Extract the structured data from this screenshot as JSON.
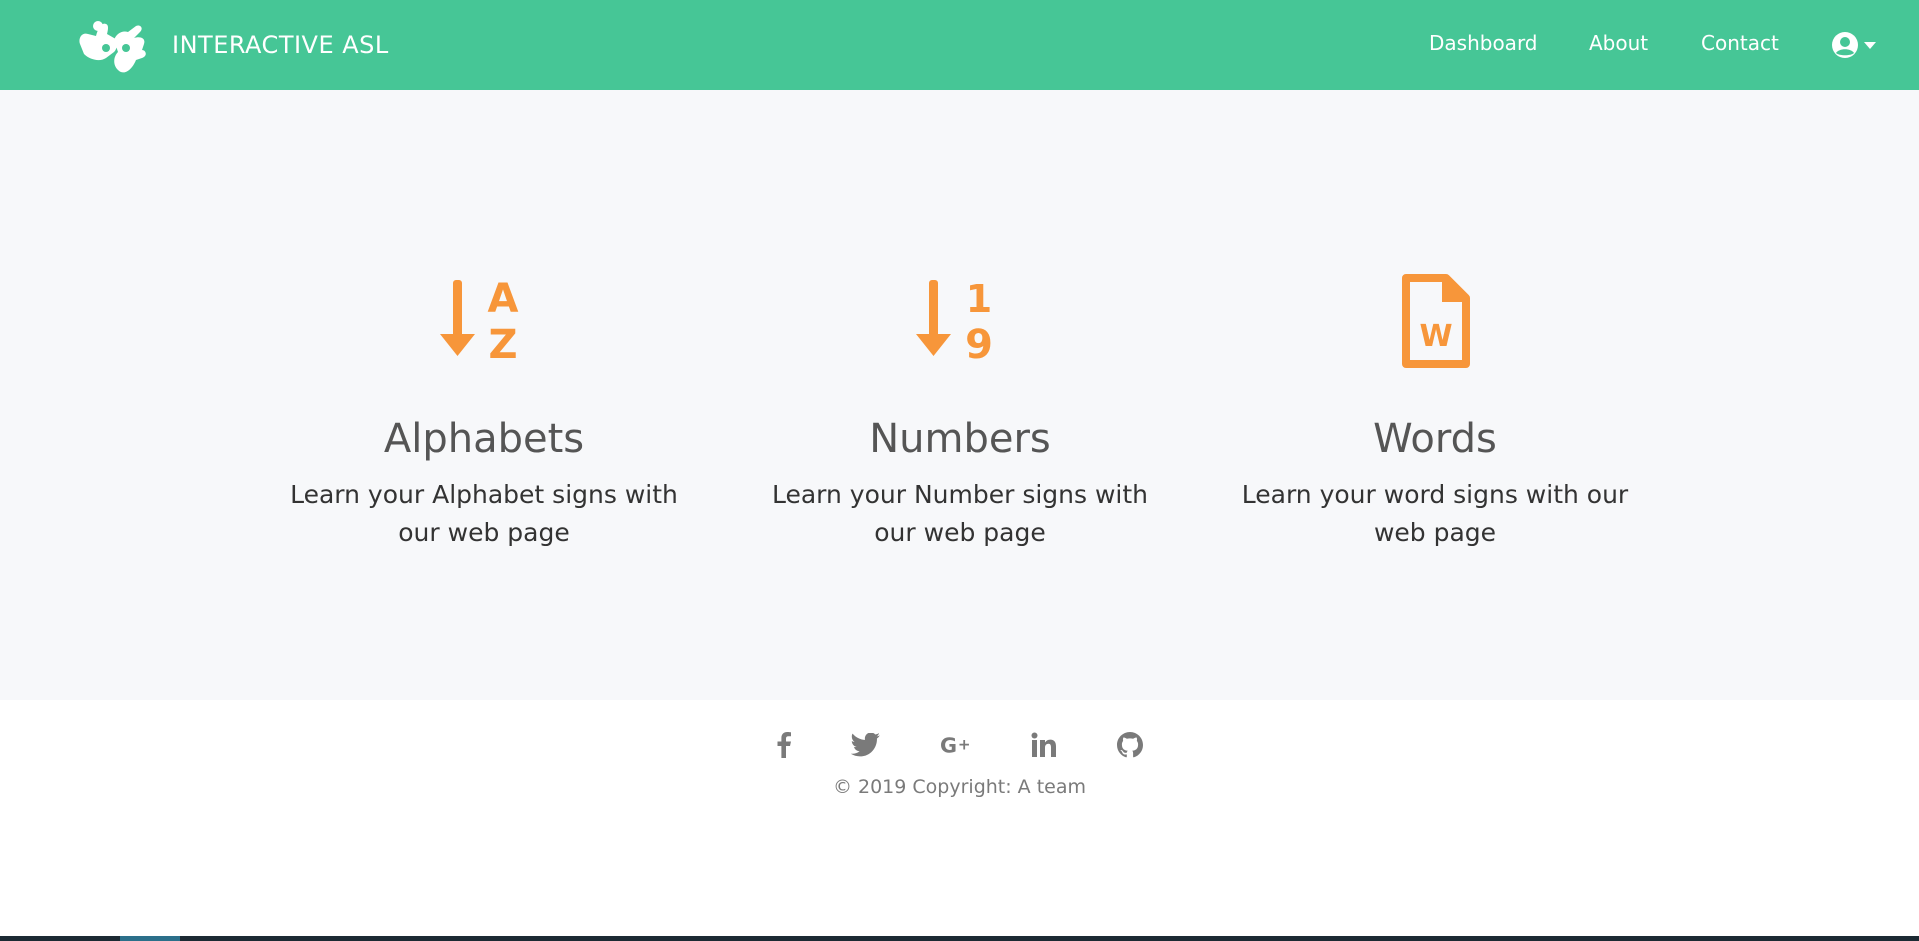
{
  "navbar": {
    "brand_title": "INTERACTIVE ASL",
    "logo_icon": "sign-language-hands-icon",
    "links": [
      {
        "label": "Dashboard"
      },
      {
        "label": "About"
      },
      {
        "label": "Contact"
      }
    ],
    "user_icon": "user-circle-icon",
    "dropdown_icon": "caret-down-icon",
    "bg_color": "#46c696"
  },
  "features": [
    {
      "icon": "sort-alpha-down-icon",
      "title": "Alphabets",
      "description": "Learn your Alphabet signs with our web page"
    },
    {
      "icon": "sort-numeric-down-icon",
      "title": "Numbers",
      "description": "Learn your Number signs with our web page"
    },
    {
      "icon": "file-word-icon",
      "title": "Words",
      "description": "Learn your word signs with our web page"
    }
  ],
  "accent_color": "#f7963a",
  "footer": {
    "social": [
      {
        "icon": "facebook-icon"
      },
      {
        "icon": "twitter-icon"
      },
      {
        "icon": "google-plus-icon"
      },
      {
        "icon": "linkedin-icon"
      },
      {
        "icon": "github-icon"
      }
    ],
    "copyright": "© 2019 Copyright: A team"
  }
}
